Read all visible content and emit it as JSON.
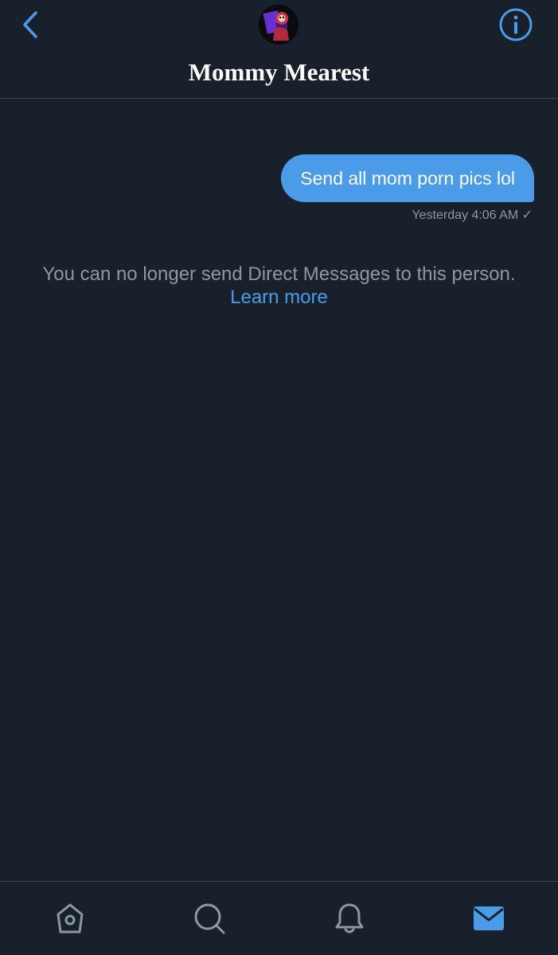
{
  "header": {
    "title": "Mommy Mearest",
    "back_icon": "chevron-left-icon",
    "info_icon": "info-icon"
  },
  "messages": [
    {
      "text": "Send all mom porn pics lol",
      "timestamp": "Yesterday 4:06 AM ✓",
      "direction": "outgoing"
    }
  ],
  "notice": {
    "text": "You can no longer send Direct Messages to this person.",
    "link_label": "Learn more"
  },
  "tabbar": {
    "tabs": [
      {
        "name": "home",
        "icon": "home-icon",
        "active": false
      },
      {
        "name": "search",
        "icon": "search-icon",
        "active": false
      },
      {
        "name": "notifications",
        "icon": "bell-icon",
        "active": false
      },
      {
        "name": "messages",
        "icon": "mail-icon",
        "active": true
      }
    ]
  },
  "colors": {
    "background": "#17202b",
    "accent": "#4a9be8",
    "muted_text": "#8b98a5",
    "divider": "#3a4552"
  }
}
